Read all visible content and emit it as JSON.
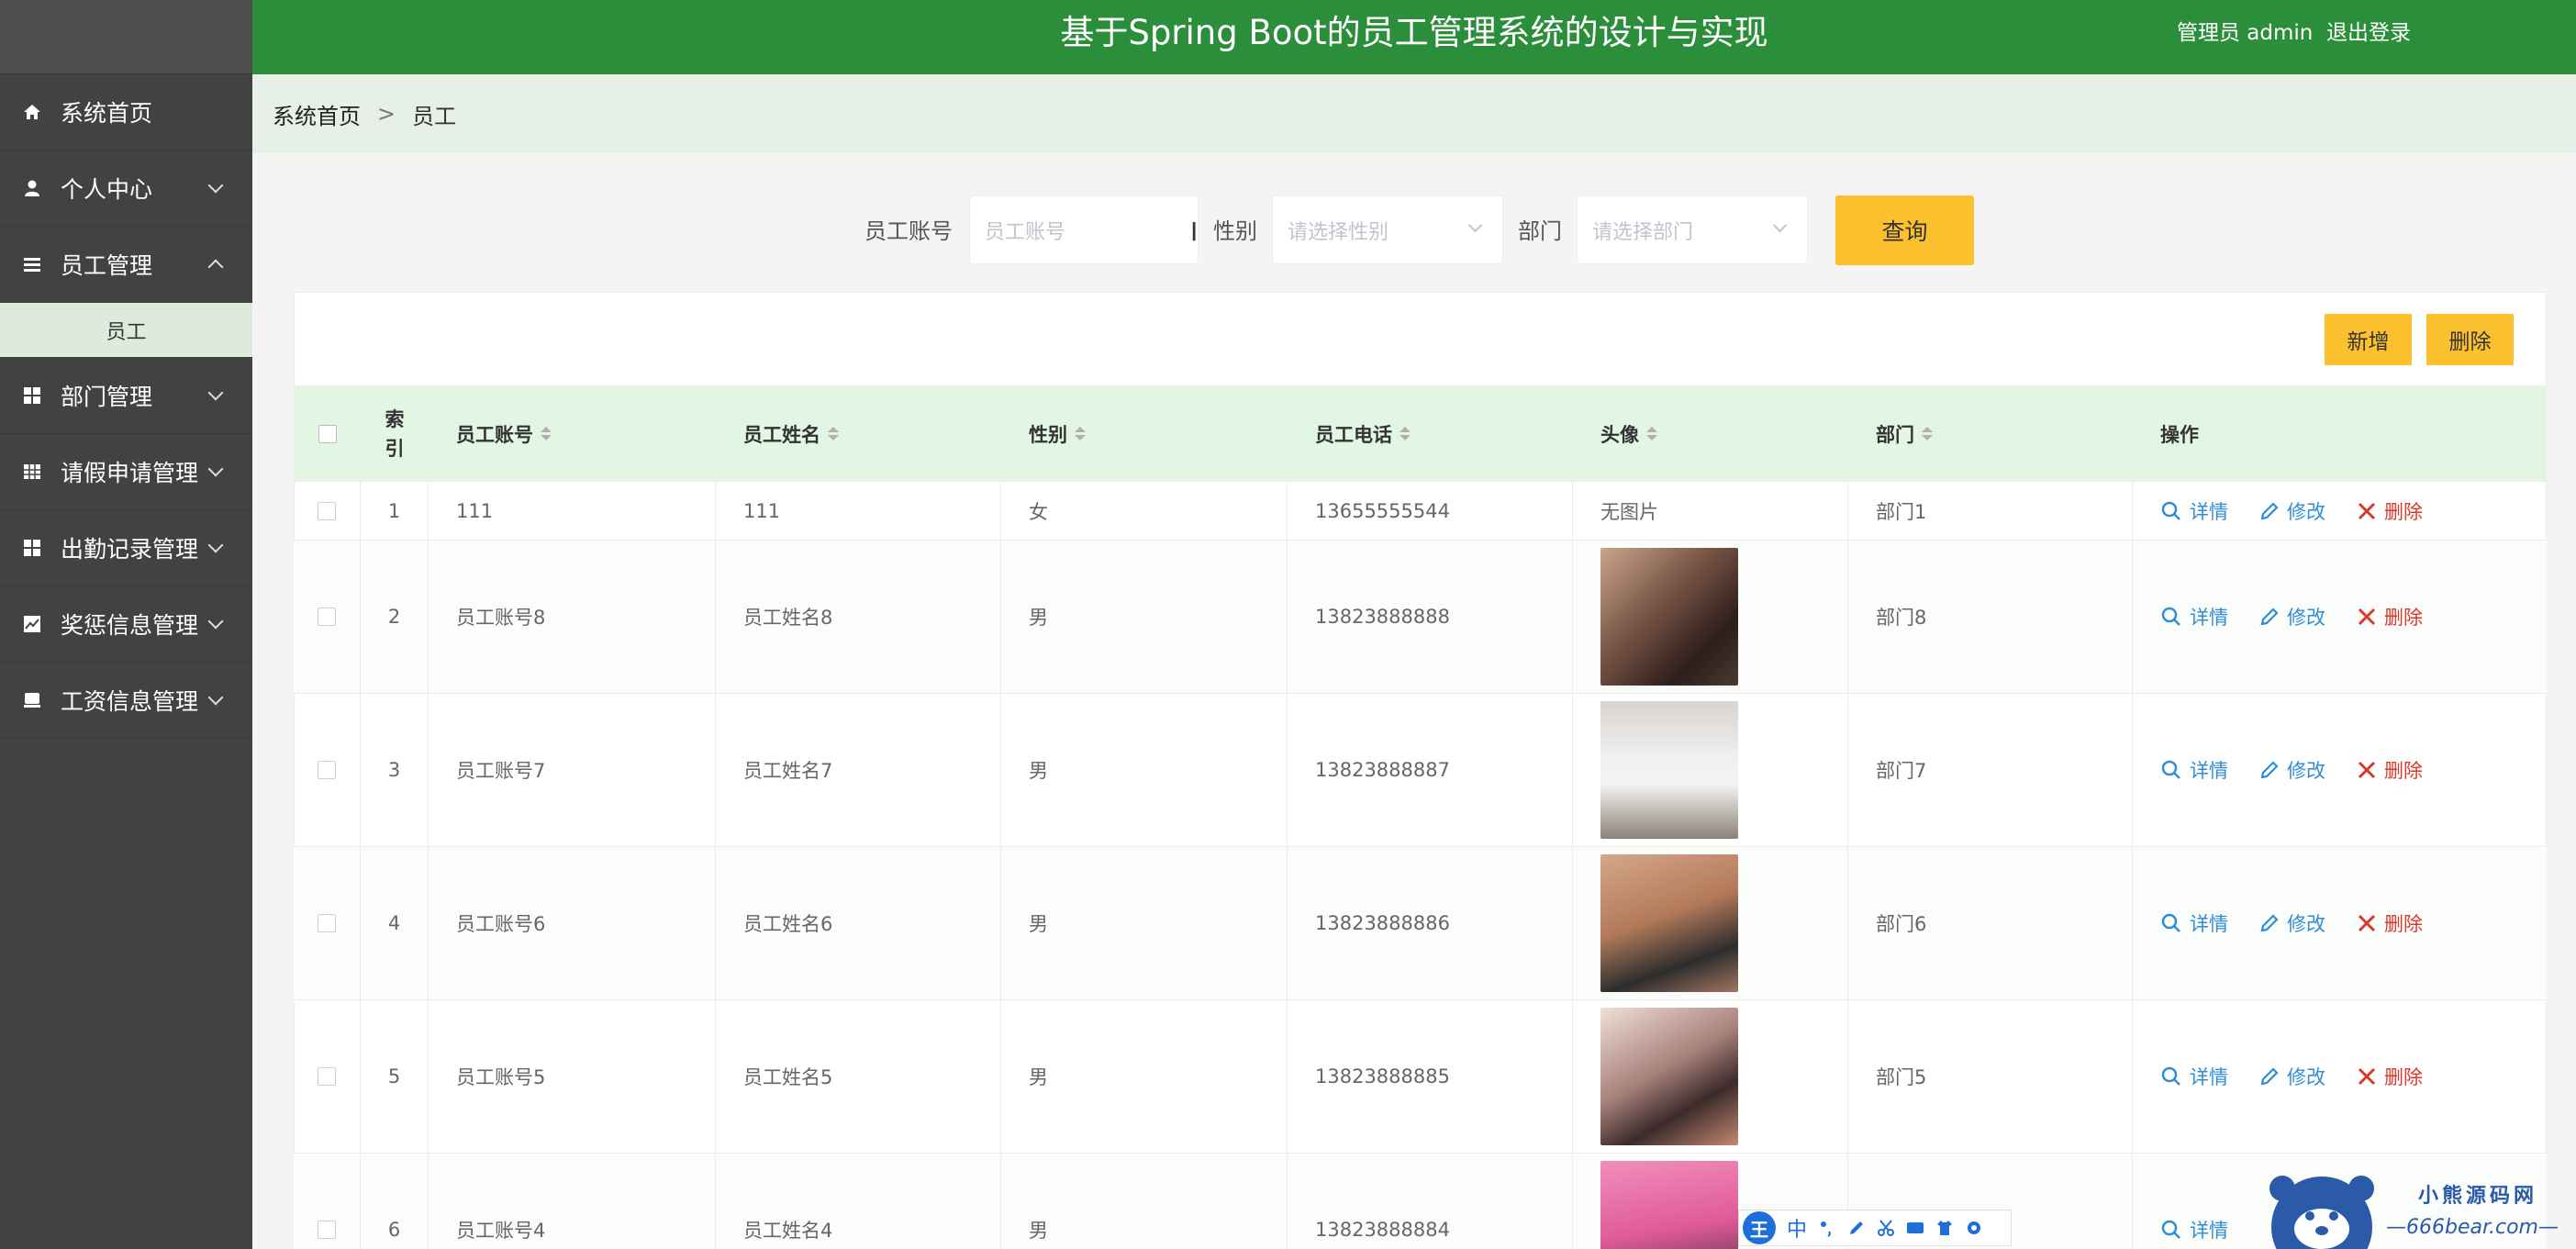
{
  "header": {
    "title": "基于Spring Boot的员工管理系统的设计与实现",
    "user": "管理员 admin",
    "logout": "退出登录"
  },
  "sidebar": {
    "items": [
      {
        "label": "系统首页",
        "icon": "home-icon",
        "chevron": "none"
      },
      {
        "label": "个人中心",
        "icon": "user-icon",
        "chevron": "down"
      },
      {
        "label": "员工管理",
        "icon": "list-icon",
        "chevron": "up"
      },
      {
        "label": "部门管理",
        "icon": "grid-icon",
        "chevron": "down"
      },
      {
        "label": "请假申请管理",
        "icon": "table-icon",
        "chevron": "down"
      },
      {
        "label": "出勤记录管理",
        "icon": "grid-icon",
        "chevron": "down"
      },
      {
        "label": "奖惩信息管理",
        "icon": "chart-icon",
        "chevron": "down"
      },
      {
        "label": "工资信息管理",
        "icon": "wallet-icon",
        "chevron": "down"
      }
    ],
    "submenu_label": "员工"
  },
  "breadcrumb": {
    "home": "系统首页",
    "separator": ">",
    "current": "员工"
  },
  "search": {
    "account_label": "员工账号",
    "account_placeholder": "员工账号",
    "gender_label": "性别",
    "gender_placeholder": "请选择性别",
    "dept_label": "部门",
    "dept_placeholder": "请选择部门",
    "query_label": "查询"
  },
  "actions": {
    "add_label": "新增",
    "delete_label": "删除"
  },
  "table": {
    "headers": {
      "index_line1": "索",
      "index_line2": "引",
      "account": "员工账号",
      "name": "员工姓名",
      "gender": "性别",
      "phone": "员工电话",
      "avatar": "头像",
      "dept": "部门",
      "ops": "操作"
    },
    "rows": [
      {
        "index": "1",
        "account": "111",
        "name": "111",
        "gender": "女",
        "phone": "13655555544",
        "avatar_text": "无图片",
        "dept": "部门1"
      },
      {
        "index": "2",
        "account": "员工账号8",
        "name": "员工姓名8",
        "gender": "男",
        "phone": "13823888888",
        "dept": "部门8"
      },
      {
        "index": "3",
        "account": "员工账号7",
        "name": "员工姓名7",
        "gender": "男",
        "phone": "13823888887",
        "dept": "部门7"
      },
      {
        "index": "4",
        "account": "员工账号6",
        "name": "员工姓名6",
        "gender": "男",
        "phone": "13823888886",
        "dept": "部门6"
      },
      {
        "index": "5",
        "account": "员工账号5",
        "name": "员工姓名5",
        "gender": "男",
        "phone": "13823888885",
        "dept": "部门5"
      },
      {
        "index": "6",
        "account": "员工账号4",
        "name": "员工姓名4",
        "gender": "男",
        "phone": "13823888884",
        "dept": ""
      }
    ],
    "op_detail": "详情",
    "op_edit": "修改",
    "op_delete": "删除"
  },
  "ime": {
    "logo": "王",
    "mode": "中"
  },
  "watermark": {
    "title": "小熊源码网",
    "url": "—666bear.com—"
  },
  "colors": {
    "header_bg": "#2a8e3a",
    "sidebar_bg": "#424242",
    "accent_yellow": "#fbc02d",
    "table_head_bg": "#e3f5e3",
    "link_blue": "#2f8dd6",
    "delete_red": "#d9382b"
  }
}
